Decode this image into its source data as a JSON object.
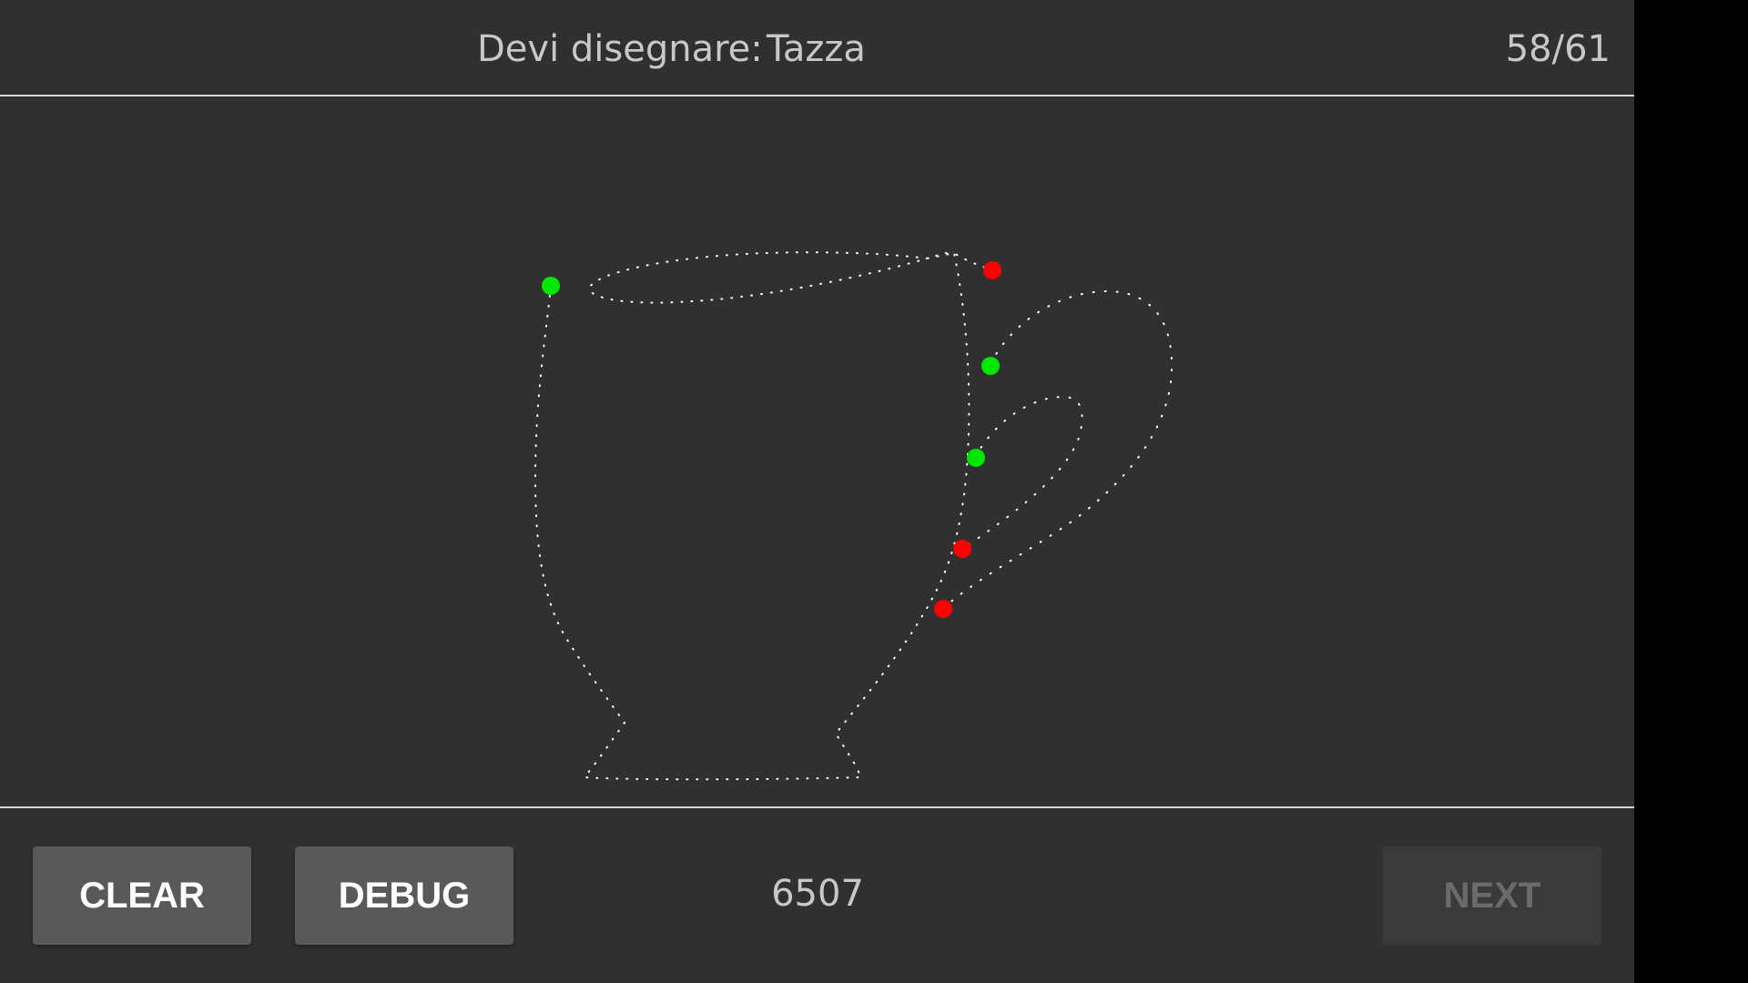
{
  "header": {
    "prompt_label": "Devi disegnare:",
    "prompt_word": "Tazza",
    "progress": "58/61"
  },
  "footer": {
    "clear_label": "CLEAR",
    "debug_label": "DEBUG",
    "score": "6507",
    "next_label": "NEXT",
    "next_enabled": false
  },
  "drawing": {
    "subject": "cup",
    "stroke_color": "#ffffff",
    "start_marker_color": "#00e600",
    "end_marker_color": "#ff0000",
    "stroke_count": 3
  },
  "colors": {
    "background": "#303030",
    "divider": "#d9d9d9",
    "button": "#595959",
    "button_disabled": "#3a3a3a"
  }
}
